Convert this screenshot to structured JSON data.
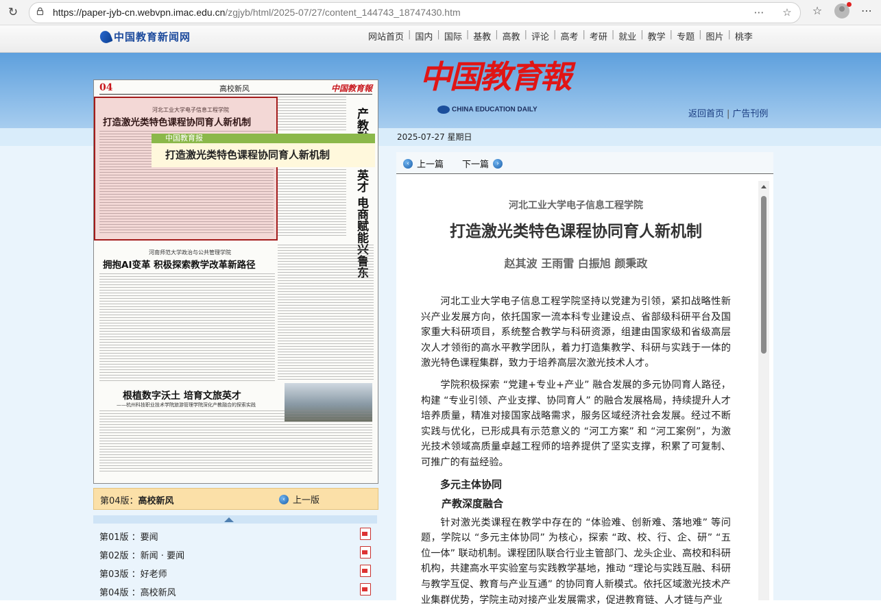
{
  "browser": {
    "url_main": "https://paper-jyb-cn.webvpn.imac.edu.cn",
    "url_path": "/zgjyb/html/2025-07/27/content_144743_18747430.htm"
  },
  "site": {
    "logo_text": "中国教育新闻网",
    "menu": [
      "网站首页",
      "国内",
      "国际",
      "基教",
      "高教",
      "评论",
      "高考",
      "考研",
      "就业",
      "教学",
      "专题",
      "图片",
      "桃李"
    ]
  },
  "masthead": {
    "title_cn": "中国教育報",
    "title_en": "CHINA EDUCATION DAILY",
    "links": [
      "返回首页",
      "广告刊例"
    ],
    "date": "2025-07-27  星期日"
  },
  "paper_page": {
    "page_no": "04",
    "section": "高校新风",
    "logo": "中国教育報",
    "highlight_kicker": "河北工业大学电子信息工程学院",
    "highlight_headline": "打造激光类特色课程协同育人新机制",
    "right_vertical_1": "产教融合",
    "right_vertical_2": "英才 电商赋能兴鲁东",
    "story2_kicker": "河南师范大学政治与公共管理学院",
    "story2_headline": "拥抱AI变革 积极探索教学改革新路径",
    "story3_headline": "根植数字沃土 培育文旅英才",
    "story3_sub": "——杭州科技职业技术学院旅游管理学院深化产教融合的探索实践",
    "tooltip_source": "中国教育报",
    "tooltip_title": "打造激光类特色课程协同育人新机制"
  },
  "version_bar": {
    "label_prefix": "第04版：",
    "label_name": "高校新风",
    "prev_label": "上一版"
  },
  "editions": [
    {
      "label": "第01版 ：要闻"
    },
    {
      "label": "第02版 ：新闻 · 要闻"
    },
    {
      "label": "第03版 ：好老师"
    },
    {
      "label": "第04版 ：高校新风"
    }
  ],
  "article_nav": {
    "prev": "上一篇",
    "next": "下一篇"
  },
  "article": {
    "kicker": "河北工业大学电子信息工程学院",
    "title": "打造激光类特色课程协同育人新机制",
    "authors": "赵其波  王雨雷  白振旭  颜秉政",
    "p1": "河北工业大学电子信息工程学院坚持以党建为引领，紧扣战略性新兴产业发展方向，依托国家一流本科专业建设点、省部级科研平台及国家重大科研项目，系统整合教学与科研资源，组建由国家级和省级高层次人才领衔的高水平教学团队，着力打造集教学、科研与实践于一体的激光特色课程集群，致力于培养高层次激光技术人才。",
    "p2": "学院积极探索 “党建+专业+产业” 融合发展的多元协同育人路径，构建 “专业引领、产业支撑、协同育人” 的融合发展格局，持续提升人才培养质量，精准对接国家战略需求，服务区域经济社会发展。经过不断实践与优化，已形成具有示范意义的 “河工方案” 和 “河工案例”，为激光技术领域高质量卓越工程师的培养提供了坚实支撑，积累了可复制、可推广的有益经验。",
    "h1": "多元主体协同",
    "h2": "产教深度融合",
    "p3": "针对激光类课程在教学中存在的 “体验难、创新难、落地难” 等问题，学院以 “多元主体协同” 为核心，探索 “政、校、行、企、研” “五位一体” 联动机制。课程团队联合行业主管部门、龙头企业、高校和科研机构，共建高水平实验室与实践教学基地，推动 “理论与实践互融、科研与教学互促、教育与产业互通” 的协同育人新模式。依托区域激光技术产业集群优势，学院主动对接产业发展需求，促进教育链、人才链与产业"
  }
}
